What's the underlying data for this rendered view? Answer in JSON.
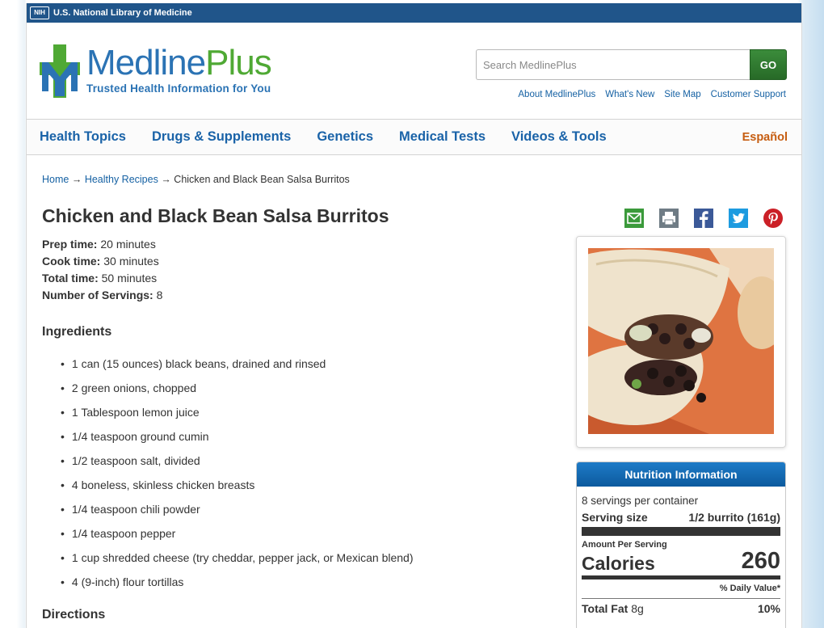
{
  "nih_bar": {
    "badge": "NIH",
    "text": "U.S. National Library of Medicine"
  },
  "logo": {
    "name_part1": "Medline",
    "name_part2": "Plus",
    "tagline": "Trusted Health Information for You"
  },
  "search": {
    "placeholder": "Search MedlinePlus",
    "button_label": "GO"
  },
  "util_links": [
    "About MedlinePlus",
    "What's New",
    "Site Map",
    "Customer Support"
  ],
  "main_nav": {
    "items": [
      "Health Topics",
      "Drugs & Supplements",
      "Genetics",
      "Medical Tests",
      "Videos & Tools"
    ],
    "language": "Español"
  },
  "breadcrumb": {
    "home": "Home",
    "sep": "→",
    "section": "Healthy Recipes",
    "current": "Chicken and Black Bean Salsa Burritos"
  },
  "recipe": {
    "title": "Chicken and Black Bean Salsa Burritos",
    "prep_label": "Prep time:",
    "prep_value": "20 minutes",
    "cook_label": "Cook time:",
    "cook_value": "30 minutes",
    "total_label": "Total time:",
    "total_value": "50 minutes",
    "servings_label": "Number of Servings:",
    "servings_value": "8",
    "ingredients_heading": "Ingredients",
    "ingredients": [
      "1 can (15 ounces) black beans, drained and rinsed",
      "2 green onions, chopped",
      "1 Tablespoon lemon juice",
      "1/4 teaspoon ground cumin",
      "1/2 teaspoon salt, divided",
      "4 boneless, skinless chicken breasts",
      "1/4 teaspoon chili powder",
      "1/4 teaspoon pepper",
      "1 cup shredded cheese (try cheddar, pepper jack, or Mexican blend)",
      "4 (9-inch) flour tortillas"
    ],
    "directions_heading": "Directions"
  },
  "share_icons": [
    "email-icon",
    "print-icon",
    "facebook-icon",
    "twitter-icon",
    "pinterest-icon"
  ],
  "nutrition": {
    "heading": "Nutrition Information",
    "servings_per_container": "8 servings per container",
    "serving_size_label": "Serving size",
    "serving_size_value": "1/2 burrito (161g)",
    "amount_per_serving": "Amount Per Serving",
    "calories_label": "Calories",
    "calories_value": "260",
    "daily_value_label": "% Daily Value*",
    "total_fat_label": "Total Fat",
    "total_fat_amount": "8g",
    "total_fat_dv": "10%"
  },
  "colors": {
    "nih_blue": "#20558a",
    "link_blue": "#1561a3",
    "brand_green": "#4fa934",
    "espanol_orange": "#c65d11"
  }
}
